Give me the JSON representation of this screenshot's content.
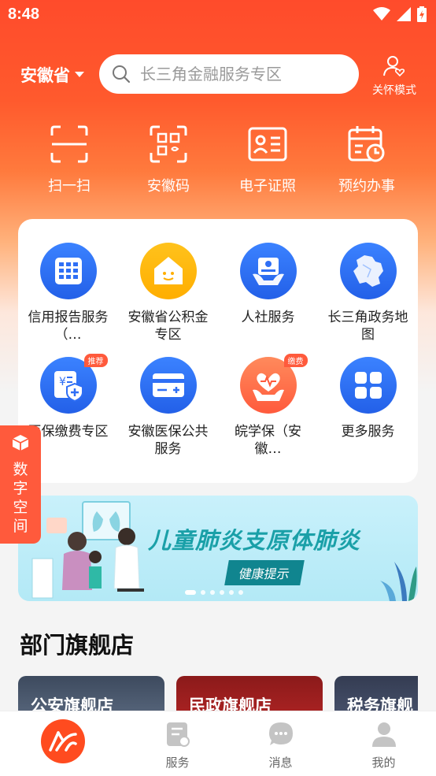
{
  "status": {
    "time": "8:48"
  },
  "header": {
    "region": "安徽省",
    "search_placeholder": "长三角金融服务专区",
    "care_mode": "关怀模式"
  },
  "quick_actions": [
    {
      "label": "扫一扫",
      "icon": "scan-icon"
    },
    {
      "label": "安徽码",
      "icon": "qr-code-icon"
    },
    {
      "label": "电子证照",
      "icon": "id-card-icon"
    },
    {
      "label": "预约办事",
      "icon": "calendar-clock-icon"
    }
  ],
  "services": [
    {
      "label": "信用报告服务（…",
      "icon": "credit-report-icon",
      "badge": ""
    },
    {
      "label": "安徽省公积金专区",
      "icon": "housing-fund-icon",
      "badge": ""
    },
    {
      "label": "人社服务",
      "icon": "social-security-card-icon",
      "badge": ""
    },
    {
      "label": "长三角政务地图",
      "icon": "map-icon",
      "badge": ""
    },
    {
      "label": "医保缴费专区",
      "icon": "medical-insurance-icon",
      "badge": "推荐"
    },
    {
      "label": "安徽医保公共服务",
      "icon": "insurance-card-icon",
      "badge": ""
    },
    {
      "label": "皖学保（安徽…",
      "icon": "student-insurance-icon",
      "badge": "缴费"
    },
    {
      "label": "更多服务",
      "icon": "more-grid-icon",
      "badge": ""
    }
  ],
  "floating_tab": {
    "label": "数字空间"
  },
  "banner": {
    "title": "儿童肺炎支原体肺炎",
    "subtitle": "健康提示",
    "pages": 6,
    "active_page": 1
  },
  "section": {
    "title": "部门旗舰店"
  },
  "stores": [
    {
      "label": "公安旗舰店"
    },
    {
      "label": "民政旗舰店"
    },
    {
      "label": "税务旗舰"
    }
  ],
  "tabbar": [
    {
      "label": "",
      "icon": "home-logo-icon"
    },
    {
      "label": "服务",
      "icon": "service-doc-icon"
    },
    {
      "label": "消息",
      "icon": "message-bubble-icon"
    },
    {
      "label": "我的",
      "icon": "user-icon"
    }
  ],
  "colors": {
    "brand": "#ff4b2b",
    "service_blue": "#2f6ff5",
    "banner_accent": "#10858f"
  }
}
